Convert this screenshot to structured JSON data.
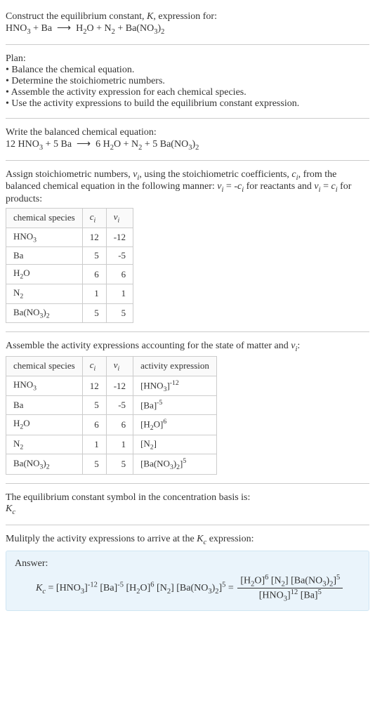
{
  "intro": {
    "line1": "Construct the equilibrium constant, K, expression for:",
    "equation": "HNO₃ + Ba ⟶ H₂O + N₂ + Ba(NO₃)₂"
  },
  "plan": {
    "heading": "Plan:",
    "items": [
      "Balance the chemical equation.",
      "Determine the stoichiometric numbers.",
      "Assemble the activity expression for each chemical species.",
      "Use the activity expressions to build the equilibrium constant expression."
    ]
  },
  "balanced": {
    "heading": "Write the balanced chemical equation:",
    "equation": "12 HNO₃ + 5 Ba ⟶ 6 H₂O + N₂ + 5 Ba(NO₃)₂"
  },
  "stoich": {
    "heading_a": "Assign stoichiometric numbers, νᵢ, using the stoichiometric coefficients, cᵢ, from the balanced chemical equation in the following manner: νᵢ = -cᵢ for reactants and νᵢ = cᵢ for products:",
    "headers": {
      "h1": "chemical species",
      "h2": "cᵢ",
      "h3": "νᵢ"
    },
    "rows": [
      {
        "sp": "HNO₃",
        "c": "12",
        "v": "-12"
      },
      {
        "sp": "Ba",
        "c": "5",
        "v": "-5"
      },
      {
        "sp": "H₂O",
        "c": "6",
        "v": "6"
      },
      {
        "sp": "N₂",
        "c": "1",
        "v": "1"
      },
      {
        "sp": "Ba(NO₃)₂",
        "c": "5",
        "v": "5"
      }
    ]
  },
  "activity": {
    "heading": "Assemble the activity expressions accounting for the state of matter and νᵢ:",
    "headers": {
      "h1": "chemical species",
      "h2": "cᵢ",
      "h3": "νᵢ",
      "h4": "activity expression"
    },
    "rows": [
      {
        "sp": "HNO₃",
        "c": "12",
        "v": "-12",
        "ae": "[HNO₃]⁻¹²"
      },
      {
        "sp": "Ba",
        "c": "5",
        "v": "-5",
        "ae": "[Ba]⁻⁵"
      },
      {
        "sp": "H₂O",
        "c": "6",
        "v": "6",
        "ae": "[H₂O]⁶"
      },
      {
        "sp": "N₂",
        "c": "1",
        "v": "1",
        "ae": "[N₂]"
      },
      {
        "sp": "Ba(NO₃)₂",
        "c": "5",
        "v": "5",
        "ae": "[Ba(NO₃)₂]⁵"
      }
    ]
  },
  "symbol": {
    "heading": "The equilibrium constant symbol in the concentration basis is:",
    "sym": "K꜀"
  },
  "final": {
    "heading": "Mulitply the activity expressions to arrive at the K꜀ expression:",
    "answer_label": "Answer:",
    "lhs": "K꜀ = [HNO₃]⁻¹² [Ba]⁻⁵ [H₂O]⁶ [N₂] [Ba(NO₃)₂]⁵ = ",
    "frac_num": "[H₂O]⁶ [N₂] [Ba(NO₃)₂]⁵",
    "frac_den": "[HNO₃]¹² [Ba]⁵"
  }
}
